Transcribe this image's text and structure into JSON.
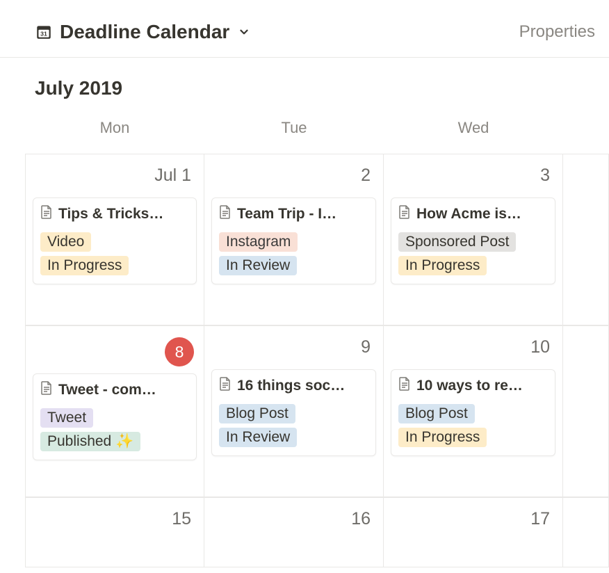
{
  "header": {
    "title": "Deadline Calendar",
    "properties": "Properties"
  },
  "month": "July 2019",
  "day_headers": [
    "Mon",
    "Tue",
    "Wed"
  ],
  "rows": [
    {
      "cells": [
        {
          "date": "Jul 1",
          "today": false,
          "event": {
            "title": "Tips & Tricks…",
            "tags": [
              {
                "text": "Video",
                "color": "yellow"
              },
              {
                "text": "In Progress",
                "color": "yellow"
              }
            ]
          }
        },
        {
          "date": "2",
          "today": false,
          "event": {
            "title": "Team Trip - I…",
            "tags": [
              {
                "text": "Instagram",
                "color": "orange"
              },
              {
                "text": "In Review",
                "color": "blue"
              }
            ]
          }
        },
        {
          "date": "3",
          "today": false,
          "event": {
            "title": "How Acme is…",
            "tags": [
              {
                "text": "Sponsored Post",
                "color": "gray"
              },
              {
                "text": "In Progress",
                "color": "yellow"
              }
            ]
          }
        },
        {
          "date": "",
          "today": false,
          "event": null
        }
      ]
    },
    {
      "cells": [
        {
          "date": "8",
          "today": true,
          "event": {
            "title": "Tweet - com…",
            "tags": [
              {
                "text": "Tweet",
                "color": "purple"
              },
              {
                "text": "Published ✨",
                "color": "green"
              }
            ]
          }
        },
        {
          "date": "9",
          "today": false,
          "event": {
            "title": "16 things soc…",
            "tags": [
              {
                "text": "Blog Post",
                "color": "blue"
              },
              {
                "text": "In Review",
                "color": "blue"
              }
            ]
          }
        },
        {
          "date": "10",
          "today": false,
          "event": {
            "title": "10 ways to re…",
            "tags": [
              {
                "text": "Blog Post",
                "color": "blue"
              },
              {
                "text": "In Progress",
                "color": "yellow"
              }
            ]
          }
        },
        {
          "date": "",
          "today": false,
          "event": null
        }
      ]
    },
    {
      "cells": [
        {
          "date": "15",
          "today": false,
          "event": null
        },
        {
          "date": "16",
          "today": false,
          "event": null
        },
        {
          "date": "17",
          "today": false,
          "event": null
        },
        {
          "date": "",
          "today": false,
          "event": null
        }
      ]
    }
  ]
}
